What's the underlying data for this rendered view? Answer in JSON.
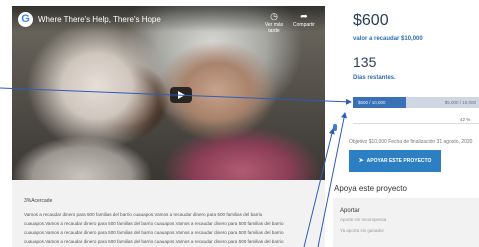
{
  "video": {
    "title": "Where There's Help, There's Hope",
    "logo_letter": "G",
    "actions": [
      {
        "icon": "clock-icon",
        "label": "Ver más tarde"
      },
      {
        "icon": "share-icon",
        "label": "Compartir"
      }
    ]
  },
  "description": {
    "heading": "3%Acercade",
    "lines": [
      "Vamos a recaudar dinero para 500 familias del barrio cuauapos.Vamos a recaudar dinero para 500 familias del barrio",
      "cuauapos.Vamos a recaudar dinero para 500 familias del barrio cuauapos.Vamos a recaudar dinero para 500 familias del barrio",
      "cuauapos.Vamos a recaudar dinero para 500 familias del barrio cuauapos.Vamos a recaudar dinero para 500 familias del barrio",
      "cuauapos.Vamos a recaudar dinero para 500 familias del barrio cuauapos.Vamos a recaudar dinero para 500 familias del barrio"
    ]
  },
  "campaign": {
    "amount": "$600",
    "goal_label": "valor a recaudar $10,000",
    "days": "135",
    "days_label": "Días restantes.",
    "progress_left": "$600 / 10,000",
    "progress_right": "$5,000 / 10,000",
    "progress_fraction": 0.42,
    "percent_label": "42 %",
    "objective_text": "Objetivo $10,000 Fecha de finalización 31 agosto, 2020",
    "cta_label": "APOYAR ESTE PROYECTO",
    "cta_icon": "send-icon"
  },
  "support": {
    "heading": "Apoya este proyecto",
    "card": {
      "title": "Aportar",
      "subtitle": "Aporte sin recompensa",
      "button": "Ya aporta sin ganador"
    }
  },
  "colors": {
    "accent": "#2d7fc4",
    "title_blue": "#2a3f5c",
    "link_blue": "#2f6fb3",
    "annotation_arrow": "#2e5db8"
  }
}
